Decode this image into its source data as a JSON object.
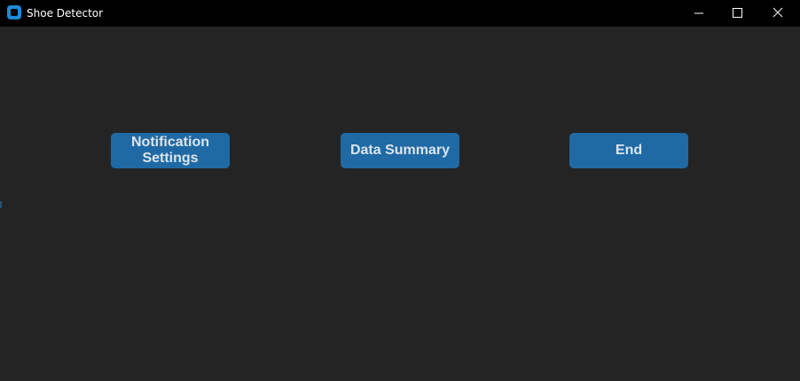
{
  "window": {
    "title": "Shoe Detector",
    "app_icon": "app-icon",
    "controls": {
      "minimize_icon": "minimize-icon",
      "maximize_icon": "maximize-icon",
      "close_icon": "close-icon"
    }
  },
  "main": {
    "buttons": {
      "notification_settings": "Notification\nSettings",
      "data_summary": "Data Summary",
      "end": "End"
    }
  },
  "colors": {
    "background": "#242424",
    "titlebar": "#000000",
    "button": "#1f6aa5",
    "button_text": "#dce4ee",
    "icon_accent": "#1f8ad6"
  }
}
